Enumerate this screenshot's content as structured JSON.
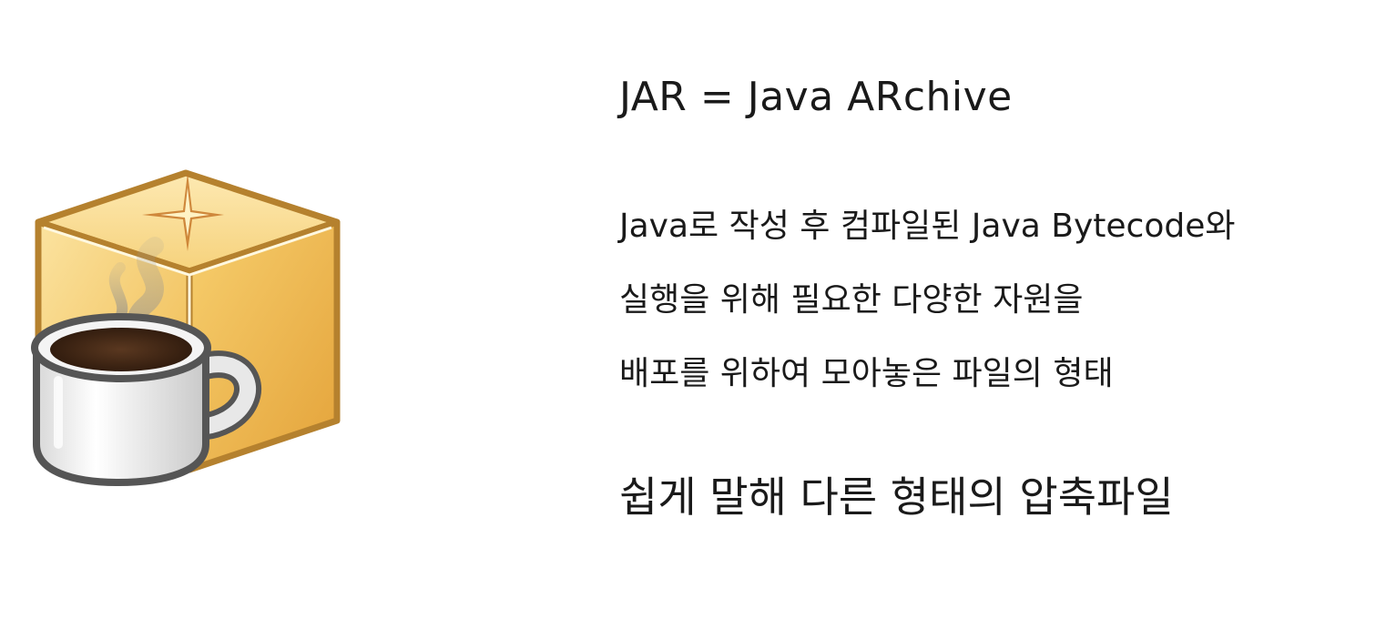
{
  "slide": {
    "title": "JAR = Java ARchive",
    "description_lines": [
      "Java로 작성 후 컴파일된 Java Bytecode와",
      "실행을 위해 필요한 다양한 자원을",
      "배포를 위하여 모아놓은 파일의 형태"
    ],
    "summary": "쉽게 말해 다른 형태의 압축파일",
    "icon": "jar-coffee-box-icon"
  },
  "colors": {
    "box_light": "#fbe7a8",
    "box_mid": "#f3c45a",
    "box_dark": "#e5a83a",
    "box_outline": "#b5812e",
    "cup_white": "#f2f2f2",
    "cup_outline": "#555555",
    "coffee": "#3b2414",
    "text": "#1a1a1a"
  }
}
